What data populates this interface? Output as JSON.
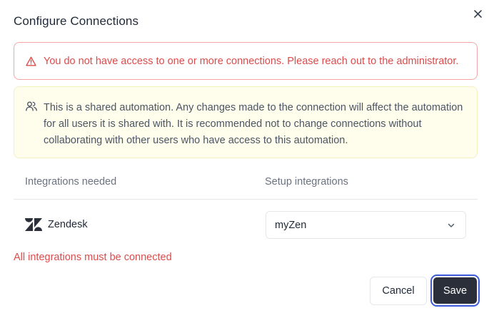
{
  "dialog": {
    "title": "Configure Connections",
    "close_icon": "close-icon"
  },
  "alerts": {
    "error": {
      "icon": "warning-triangle-icon",
      "message": "You do not have access to one or more connections. Please reach out to the administrator."
    },
    "warning": {
      "icon": "users-icon",
      "message": "This is a shared automation. Any changes made to the connection will affect the automation for all users it is shared with. It is recommended not to change connections without collaborating with other users who have access to this automation."
    }
  },
  "table": {
    "columns": [
      "Integrations needed",
      "Setup integrations"
    ],
    "rows": [
      {
        "integration": "Zendesk",
        "icon": "zendesk-logo-icon",
        "selected": "myZen"
      }
    ]
  },
  "validation_error": "All integrations must be connected",
  "buttons": {
    "cancel": "Cancel",
    "save": "Save"
  },
  "colors": {
    "error": "#dc4b4b",
    "warning_bg": "#fffdec",
    "primary_button": "#2b2f3a",
    "focus_ring": "#3b5bdb"
  }
}
